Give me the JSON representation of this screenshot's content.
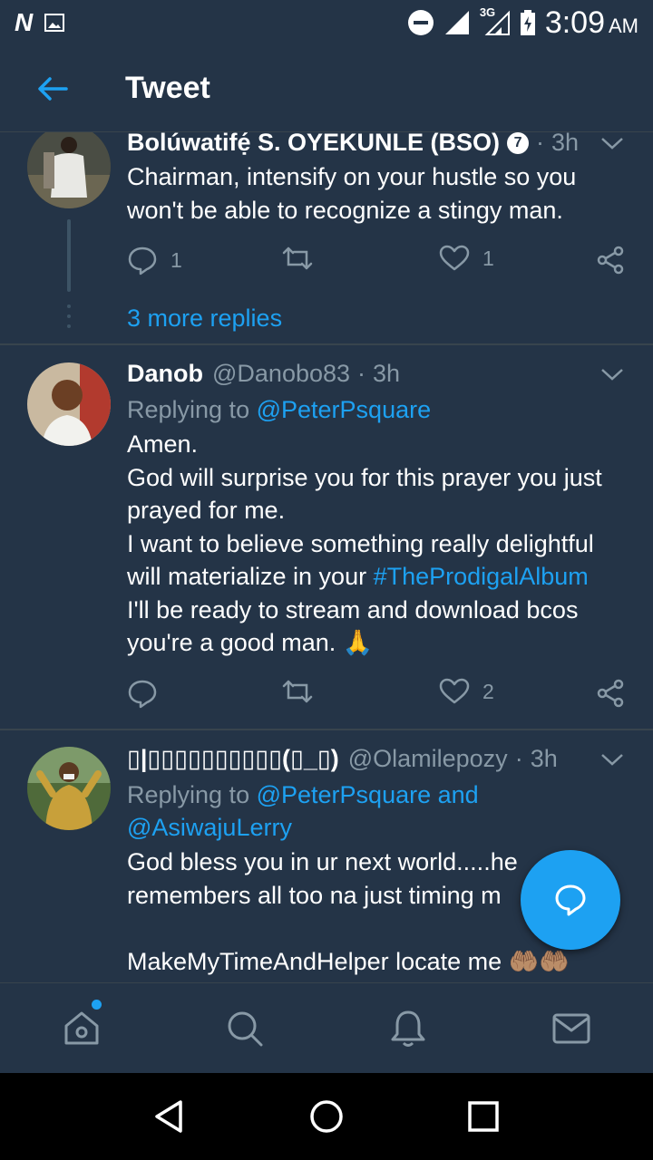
{
  "status_bar": {
    "carrier_glyph": "N",
    "network": "3G",
    "time": "3:09",
    "ampm": "AM"
  },
  "header": {
    "title": "Tweet"
  },
  "tweets": [
    {
      "name": "Bolúwatifẹ́ S. OYEKUNLE (BSO)",
      "badge": "7",
      "time": "3h",
      "text": "Chairman, intensify on your hustle so you won't be able to recognize a stingy man.",
      "reply_count": "1",
      "like_count": "1"
    },
    {
      "name": "Danob",
      "handle": "@Danobo83",
      "time": "3h",
      "replying_label": "Replying to",
      "replying_to": "@PeterPsquare",
      "text_before": "Amen.\nGod will surprise you for this prayer you just prayed for me.\nI want to believe something really delightful will materialize in your ",
      "hashtag": "#TheProdigalAlbum",
      "text_after": "\nI'll be ready to stream and download bcos you're a good man. 🙏",
      "like_count": "2"
    },
    {
      "name": "▯|▯▯▯▯▯▯▯▯▯▯(▯_▯)",
      "handle": "@Olamilepozy",
      "time": "3h",
      "replying_label": "Replying to",
      "replying_to_1": "@PeterPsquare",
      "replying_and": "and",
      "replying_to_2": "@AsiwajuLerry",
      "text": "God bless you in ur next world.....he remembers all too na just timing m\n\nMakeMyTimeAndHelper locate me 🤲🏽🤲🏽"
    }
  ],
  "more_replies": "3 more replies",
  "colors": {
    "background": "#243447",
    "accent": "#1da1f2",
    "muted": "#8899a6",
    "divider": "#38444d"
  },
  "icons": {
    "nav": [
      "home-icon",
      "search-icon",
      "notifications-icon",
      "messages-icon"
    ],
    "system": [
      "back-triangle-icon",
      "home-circle-icon",
      "recents-square-icon"
    ]
  }
}
